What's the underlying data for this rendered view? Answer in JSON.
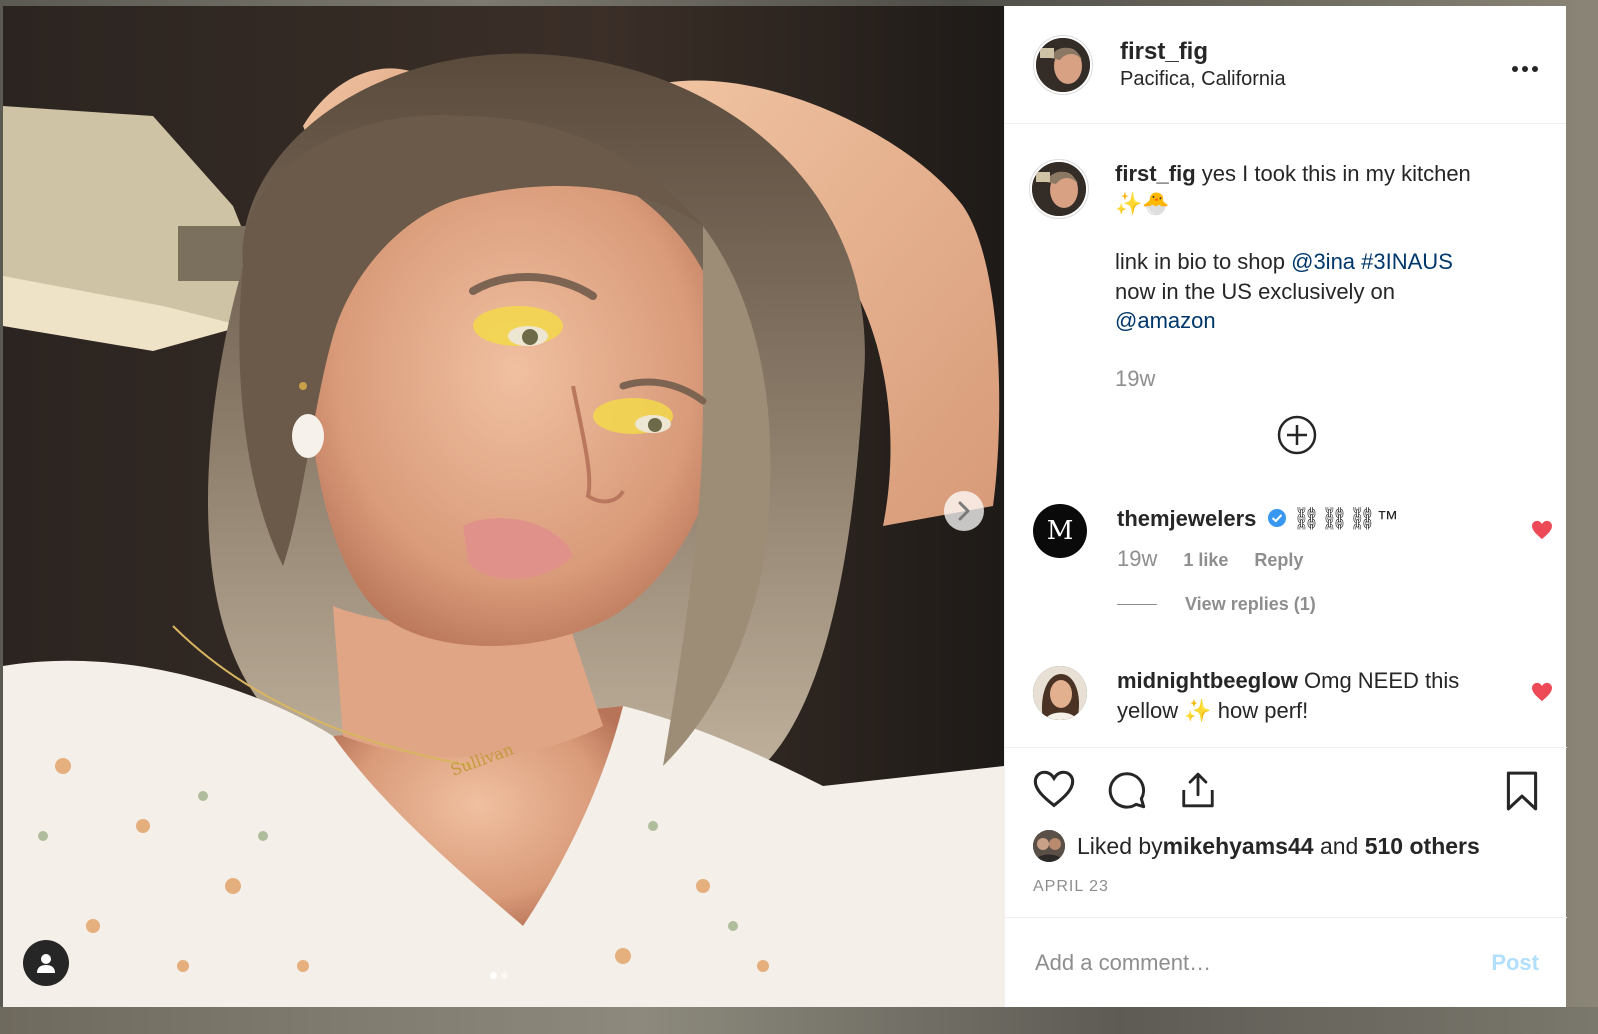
{
  "post": {
    "username": "first_fig",
    "location": "Pacifica, California",
    "more_icon": "⋯",
    "image_alt_icon": "selfie-photo"
  },
  "caption": {
    "username": "first_fig",
    "text_line1": " yes I took this in my kitchen",
    "emoji_line": "✨🐣",
    "text_line2": "link in bio to shop ",
    "mention1": "@3ina",
    "hashtag": " #3INAUS",
    "text_line3": "now in the US exclusively on",
    "mention2": "@amazon",
    "time": "19w"
  },
  "comments": [
    {
      "username": "themjewelers",
      "text": " ⛓⛓⛓™",
      "time": "19w",
      "likes": "1 like",
      "reply": "Reply",
      "view_replies": "View replies (1)",
      "avatar_letter": "M"
    },
    {
      "username": "midnightbeeglow",
      "text": " Omg NEED this yellow ✨ how perf!"
    }
  ],
  "likes": {
    "prefix": "Liked by ",
    "user": "mikehyams44",
    "middle": " and ",
    "others": "510 others"
  },
  "date": "APRIL 23",
  "add_comment": {
    "placeholder": "Add a comment…",
    "post_label": "Post"
  },
  "colors": {
    "link": "#00376b",
    "heart": "#ed4956",
    "verified": "#3897f0",
    "post_disabled": "#b2dffc"
  }
}
